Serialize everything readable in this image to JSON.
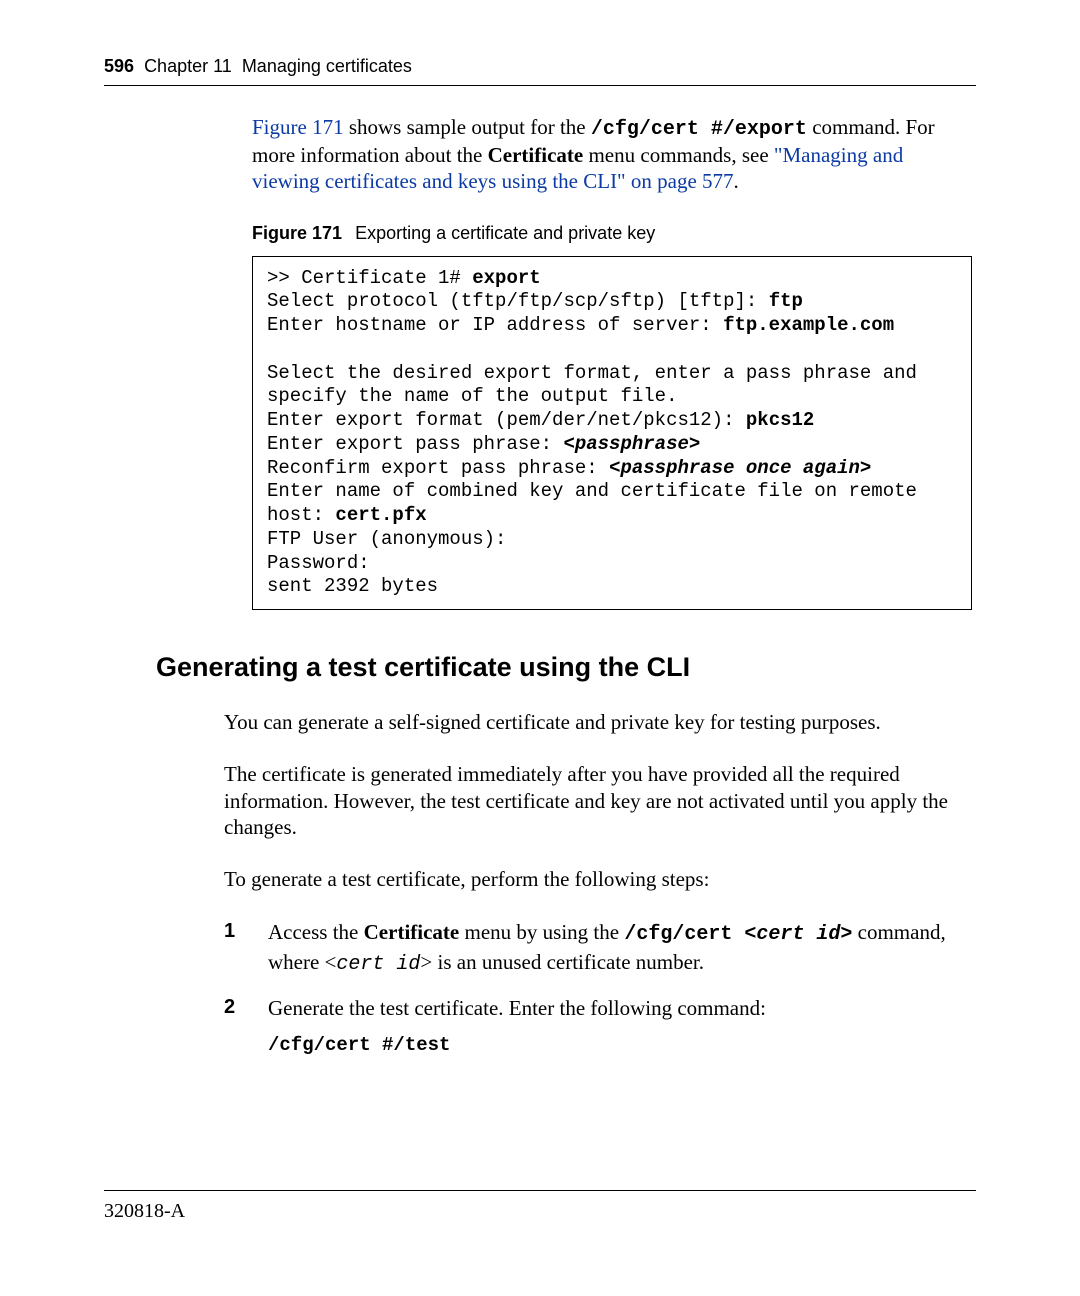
{
  "header": {
    "page_number": "596",
    "chapter_label": "Chapter 11",
    "chapter_title": "Managing certificates"
  },
  "intro": {
    "xref_figure": "Figure 171",
    "sentence_after_figref": " shows sample output for the ",
    "export_cmd": "/cfg/cert #/export",
    "sentence_end": " command. For more information about the ",
    "bold_word": "Certificate",
    "sentence_end2": " menu commands, see ",
    "xref_link": "\"Managing and viewing certificates and keys using the CLI\" on page 577",
    "period": "."
  },
  "figure": {
    "label": "Figure 171",
    "caption": "Exporting a certificate and private key"
  },
  "code": {
    "l1a": ">> Certificate 1# ",
    "l1b": "export",
    "l2a": "Select protocol (tftp/ftp/scp/sftp) [tftp]: ",
    "l2b": "ftp",
    "l3a": "Enter hostname or IP address of server: ",
    "l3b": "ftp.example.com",
    "blank": "",
    "l4": "Select the desired export format, enter a pass phrase and specify the name of the output file.",
    "l5a": "Enter export format (pem/der/net/pkcs12): ",
    "l5b": "pkcs12",
    "l6a": "Enter export pass phrase: ",
    "l6b": "<passphrase>",
    "l7a": "Reconfirm export pass phrase: ",
    "l7b": "<passphrase once again>",
    "l8a": "Enter name of combined key and certificate file on remote host: ",
    "l8b": "cert.pfx",
    "l9": "FTP User (anonymous):",
    "l10": "Password:",
    "l11": "sent 2392 bytes"
  },
  "section": {
    "heading": "Generating a test certificate using the CLI",
    "p1": "You can generate a self-signed certificate and private key for testing purposes.",
    "p2": "The certificate is generated immediately after you have provided all the required information. However, the test certificate and key are not activated until you apply the changes.",
    "p3": "To generate a test certificate, perform the following steps:"
  },
  "steps": {
    "s1": {
      "num": "1",
      "t1": "Access the ",
      "bold": "Certificate",
      "t2": " menu by using the ",
      "cmd_pre": "/cfg/cert ",
      "cmd_var": "<cert id>",
      "t3": " command, where <",
      "var": "cert id",
      "t4": "> is an unused certificate number."
    },
    "s2": {
      "num": "2",
      "t1": "Generate the test certificate. Enter the following command:",
      "cmd": "/cfg/cert #/test"
    }
  },
  "footer": {
    "docnum": "320818-A"
  }
}
